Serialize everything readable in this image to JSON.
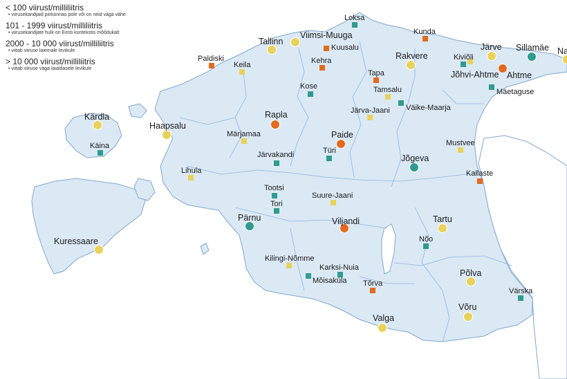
{
  "legend": [
    {
      "title": "< 100 viirust/milliliitris",
      "desc": "viirusekandjaid piirkonnas pole või on neid väga vähe"
    },
    {
      "title": "101 - 1999 viirust/milliliitris",
      "desc": "viirusekandjate hulk on Eesti kontekstis mõõdukalt"
    },
    {
      "title": "2000 - 10 000 viirust/milliliitris",
      "desc": "viitab viiruse laiemale levikule"
    },
    {
      "title": "> 10 000 viirust/milliliitris",
      "desc": "viitab viiruse väga laialdasele levikule"
    }
  ],
  "colors": {
    "land": "#dbe9f5",
    "border": "#7fa7cf",
    "low": "#2f9b8e",
    "moderate": "#e8d25a",
    "wide": "#e36a1e",
    "very_wide": "#c0392b"
  },
  "places": [
    {
      "name": "Loksa",
      "level": "low",
      "marker": "square"
    },
    {
      "name": "Kunda",
      "level": "wide",
      "marker": "square"
    },
    {
      "name": "Viimsi-Muuga",
      "level": "moderate",
      "marker": "circle"
    },
    {
      "name": "Tallinn",
      "level": "moderate",
      "marker": "circle"
    },
    {
      "name": "Kuusalu",
      "level": "wide",
      "marker": "square"
    },
    {
      "name": "Järve",
      "level": "moderate",
      "marker": "circle"
    },
    {
      "name": "Sillamäe",
      "level": "low",
      "marker": "circle"
    },
    {
      "name": "Na",
      "level": "moderate",
      "marker": "circle"
    },
    {
      "name": "Paldiski",
      "level": "wide",
      "marker": "square"
    },
    {
      "name": "Keila",
      "level": "moderate",
      "marker": "square"
    },
    {
      "name": "Kehra",
      "level": "wide",
      "marker": "square"
    },
    {
      "name": "Rakvere",
      "level": "moderate",
      "marker": "circle"
    },
    {
      "name": "Kiviõli",
      "level": "low",
      "marker": "square"
    },
    {
      "name": "Jõhvi-Ahtme",
      "level": "moderate",
      "marker": "square"
    },
    {
      "name": "Ahtme",
      "level": "wide",
      "marker": "circle"
    },
    {
      "name": "Tapa",
      "level": "wide",
      "marker": "square"
    },
    {
      "name": "Mäetaguse",
      "level": "low",
      "marker": "square"
    },
    {
      "name": "Kose",
      "level": "low",
      "marker": "square"
    },
    {
      "name": "Tamsalu",
      "level": "moderate",
      "marker": "square"
    },
    {
      "name": "Väike-Maarja",
      "level": "low",
      "marker": "square"
    },
    {
      "name": "Järva-Jaani",
      "level": "moderate",
      "marker": "square"
    },
    {
      "name": "Rapla",
      "level": "wide",
      "marker": "circle"
    },
    {
      "name": "Kärdla",
      "level": "moderate",
      "marker": "circle"
    },
    {
      "name": "Haapsalu",
      "level": "moderate",
      "marker": "circle"
    },
    {
      "name": "Märjamaa",
      "level": "moderate",
      "marker": "square"
    },
    {
      "name": "Paide",
      "level": "wide",
      "marker": "circle"
    },
    {
      "name": "Mustvee",
      "level": "moderate",
      "marker": "square"
    },
    {
      "name": "Käina",
      "level": "low",
      "marker": "square"
    },
    {
      "name": "Türi",
      "level": "low",
      "marker": "square"
    },
    {
      "name": "Järvakandi",
      "level": "low",
      "marker": "square"
    },
    {
      "name": "Jõgeva",
      "level": "low",
      "marker": "circle"
    },
    {
      "name": "Lihula",
      "level": "moderate",
      "marker": "square"
    },
    {
      "name": "Kallaste",
      "level": "wide",
      "marker": "square"
    },
    {
      "name": "Tootsi",
      "level": "low",
      "marker": "square"
    },
    {
      "name": "Suure-Jaani",
      "level": "moderate",
      "marker": "square"
    },
    {
      "name": "Tori",
      "level": "low",
      "marker": "square"
    },
    {
      "name": "Pärnu",
      "level": "low",
      "marker": "circle"
    },
    {
      "name": "Viljandi",
      "level": "wide",
      "marker": "circle"
    },
    {
      "name": "Tartu",
      "level": "moderate",
      "marker": "circle"
    },
    {
      "name": "Kuressaare",
      "level": "moderate",
      "marker": "circle"
    },
    {
      "name": "Nõo",
      "level": "low",
      "marker": "square"
    },
    {
      "name": "Kilingi-Nõmme",
      "level": "moderate",
      "marker": "square"
    },
    {
      "name": "Karksi-Nuia",
      "level": "low",
      "marker": "square"
    },
    {
      "name": "Mõisaküla",
      "level": "low",
      "marker": "square"
    },
    {
      "name": "Põlva",
      "level": "moderate",
      "marker": "circle"
    },
    {
      "name": "Tõrva",
      "level": "wide",
      "marker": "square"
    },
    {
      "name": "Värska",
      "level": "low",
      "marker": "square"
    },
    {
      "name": "Võru",
      "level": "moderate",
      "marker": "circle"
    },
    {
      "name": "Valga",
      "level": "moderate",
      "marker": "circle"
    }
  ]
}
